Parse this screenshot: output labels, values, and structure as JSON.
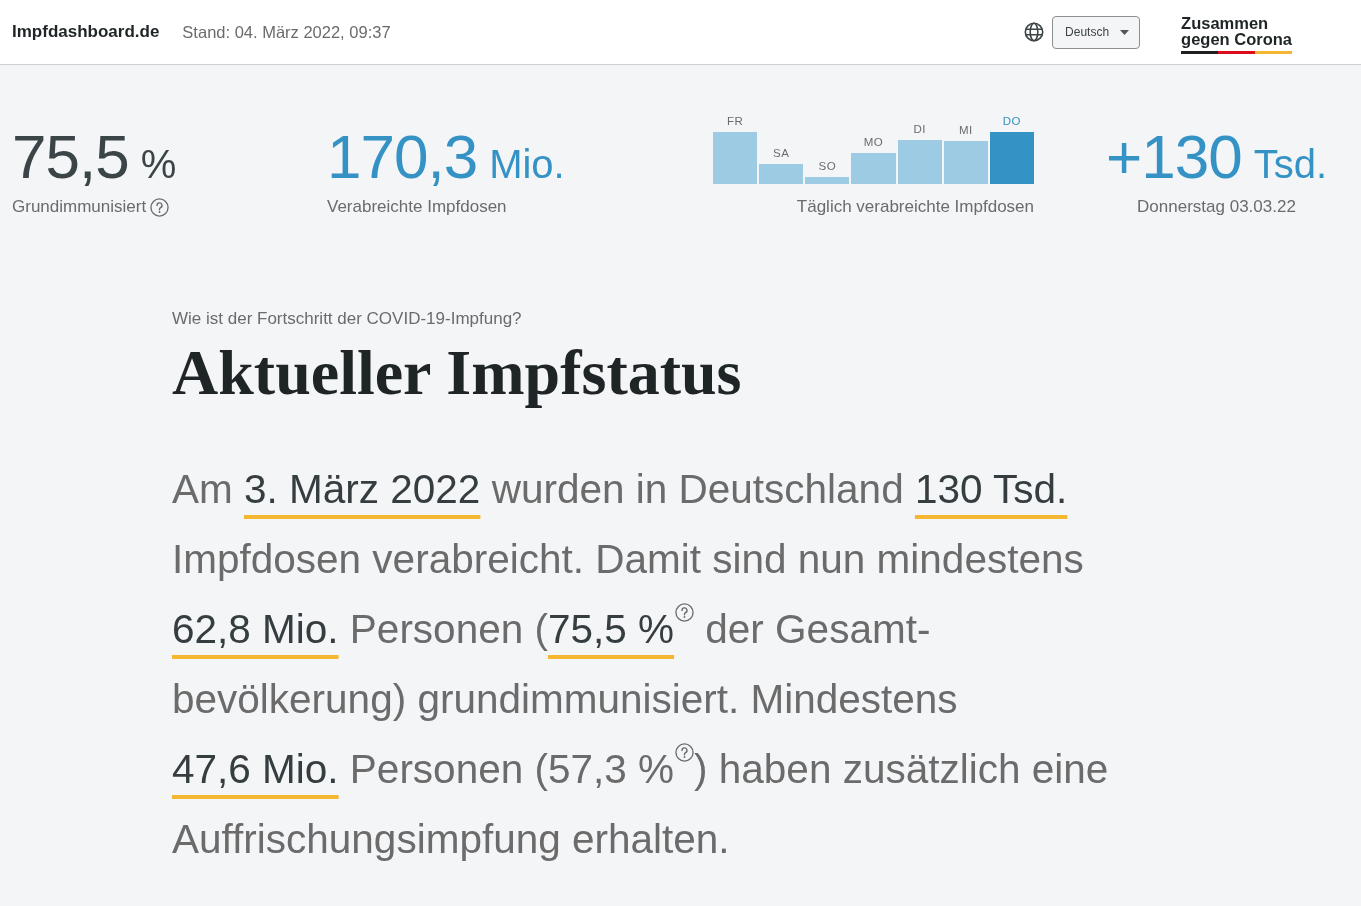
{
  "header": {
    "site_name": "Impfdashboard.de",
    "updated": "Stand: 04. März 2022, 09:37",
    "language": "Deutsch",
    "logo": {
      "lines": [
        "Zusammen",
        "gegen Corona"
      ]
    }
  },
  "stats": [
    {
      "kind": "number",
      "value": "75,5",
      "unit": "%",
      "label": "Grundimmunisiert",
      "help": true,
      "color": "#3b4447"
    },
    {
      "kind": "number",
      "value": "170,3",
      "unit": "Mio.",
      "label": "Verabreichte Impfdosen",
      "color": "#3592c5"
    },
    {
      "kind": "chart",
      "label": "Täglich verabreichte Impfdosen",
      "days": [
        {
          "label": "FR",
          "selected": false
        },
        {
          "label": "SA",
          "selected": false
        },
        {
          "label": "SO",
          "selected": false
        },
        {
          "label": "MO",
          "selected": false
        },
        {
          "label": "DI",
          "selected": false
        },
        {
          "label": "MI",
          "selected": false
        },
        {
          "label": "DO",
          "selected": true
        }
      ]
    },
    {
      "kind": "number",
      "value": "+130",
      "unit": "Tsd.",
      "label": "Donnerstag 03.03.22",
      "color": "#3592c5"
    }
  ],
  "intro": {
    "question": "Wie ist der Fortschritt der COVID-19-Impfung?",
    "title": "Aktueller Impfstatus",
    "summary": {
      "lines": [
        [
          {
            "kind": "text",
            "text": "Am **3. März 2022** wurden in Deutschland **130 Tsd.**"
          }
        ],
        [
          {
            "kind": "text",
            "text": "Impfdosen verabreicht. Damit sind nun mindestens"
          }
        ],
        [
          {
            "kind": "text",
            "text": "**62,8 Mio.** Personen (**75,5 %**"
          },
          {
            "kind": "help"
          },
          {
            "kind": "text",
            "text": " der Gesamt-"
          }
        ],
        [
          {
            "kind": "text",
            "text": "bevölkerung) grundimmunisiert. Mindestens"
          }
        ],
        [
          {
            "kind": "text",
            "text": "**47,6 Mio.** Personen (57,3 %"
          },
          {
            "kind": "help"
          },
          {
            "kind": "text",
            "text": ") haben zusätzlich eine"
          }
        ],
        [
          {
            "kind": "text",
            "text": "Auffrischungsimpfung erhalten."
          }
        ]
      ]
    }
  }
}
